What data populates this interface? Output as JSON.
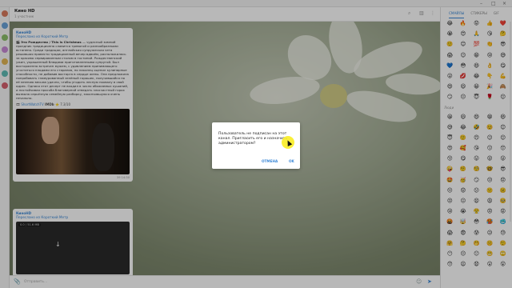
{
  "window": {
    "title": "Кино НD"
  },
  "chat": {
    "title": "Кино НD",
    "subtitle": "1 участник"
  },
  "messages": [
    {
      "from": "КиноНD",
      "forwarded": "Переслано из Короткий Метр",
      "title": "Это Рождество / This is Christmas",
      "text": " — чудесный зимний праздник традиционно славится тревогой и разнообразными встанено. Среди традиции, английская супружеская чета решившая провести традиционный вечер вдвоём, расположилась за красиво сервированным столом в гостиной. Рождественский ужин, украшенный блюдами приготовленными супругой. Был восторженно встречен мужем, с удивлением принимающего угоститься плодами его старания, но наконец оценил кулинарные способности, не добавив восторга в сердце жены. Она предложила попробовать гламурованный зелёный горошек, получившийся по её мнению весьма удачно, чтобы угодить лесную похвалу в свой адрес. Однако этот десерт не входил в число обожаемых кушаний, и настойчивая просьба благоверной отведать злосчастный горох вызвала серьёзную семейную разборку, закончившуюся очень печально.",
      "imdb_link": "ShortWatchTV",
      "imdb_label": "IMDb",
      "imdb_rating": "7.3/10",
      "meta": "39 14:30"
    },
    {
      "from": "КиноНD",
      "forwarded": "Переслано из Короткий Метр",
      "video_size": "0.0 / 51.6 MB",
      "download": "↓"
    }
  ],
  "composer": {
    "placeholder": "Отправить..."
  },
  "emoji_panel": {
    "tabs": [
      "СМАЙЛЫ",
      "СТИКЕРЫ",
      "GIF"
    ],
    "active_tab": "СМАЙЛЫ",
    "recent": [
      "😂",
      "🔥",
      "😡",
      "👍",
      "❤️",
      "😭",
      "😍",
      "🙏",
      "😘",
      "🤔",
      "🙂",
      "😊",
      "💯",
      "👏",
      "😎",
      "😱",
      "😉",
      "😁",
      "😢",
      "😅",
      "💙",
      "😳",
      "😆",
      "👌",
      "😋",
      "😜",
      "💋",
      "😂",
      "👇",
      "💪",
      "😄",
      "😃",
      "😀",
      "🎉",
      "🙈",
      "😏",
      "😐",
      "😇",
      "🌹",
      "😌"
    ],
    "section_label": "Люди",
    "people": [
      "😀",
      "😃",
      "😄",
      "😁",
      "😆",
      "😅",
      "😂",
      "🤣",
      "☺️",
      "😊",
      "😇",
      "🙂",
      "🙃",
      "😉",
      "😌",
      "😍",
      "🥰",
      "😘",
      "😗",
      "😙",
      "😚",
      "😋",
      "😛",
      "😝",
      "😜",
      "🤪",
      "🤨",
      "🧐",
      "🤓",
      "😎",
      "🤩",
      "🥳",
      "😏",
      "😒",
      "😞",
      "😔",
      "😟",
      "😕",
      "🙁",
      "☹️",
      "😣",
      "😖",
      "😫",
      "😩",
      "🥺",
      "😢",
      "😭",
      "😤",
      "😠",
      "😡",
      "🤬",
      "🤯",
      "😳",
      "🥵",
      "🥶",
      "😱",
      "😨",
      "😰",
      "😥",
      "😓",
      "🤗",
      "🤔",
      "🤭",
      "🤫",
      "🤥",
      "😶",
      "😐",
      "😑",
      "😬",
      "🙄",
      "😯",
      "😦",
      "😧",
      "😮",
      "😲"
    ]
  },
  "dialog": {
    "message": "Пользователь не подписан на этот канал. Пригласить его и назначить администратором?",
    "cancel": "ОТМЕНА",
    "ok": "OK"
  }
}
